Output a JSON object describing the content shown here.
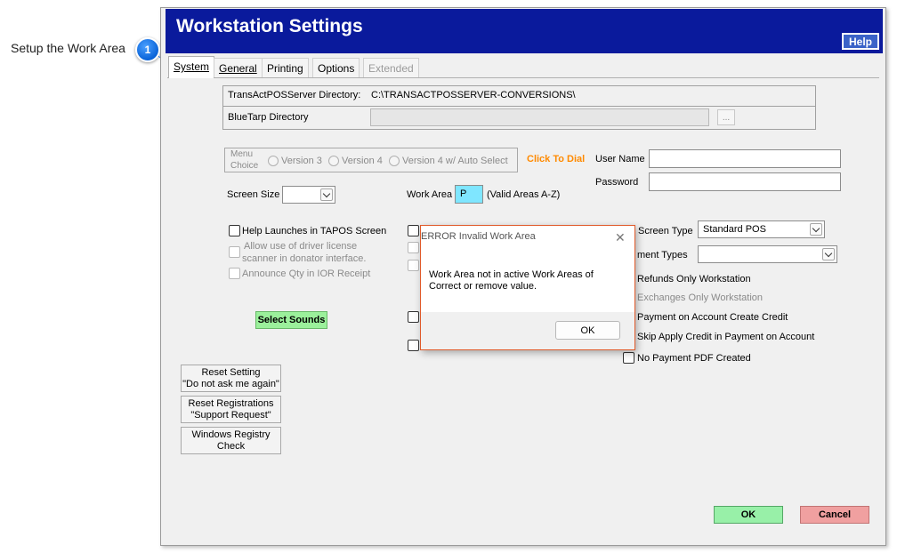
{
  "callout": {
    "label": "Setup the Work Area",
    "number": "1"
  },
  "window": {
    "title": "Workstation Settings",
    "help_label": "Help"
  },
  "tabs": [
    {
      "label": "System"
    },
    {
      "label": "General"
    },
    {
      "label": "Printing"
    },
    {
      "label": "Options"
    },
    {
      "label": "Extended"
    }
  ],
  "directories": {
    "server_label": "TransActPOSServer Directory:",
    "server_value": "C:\\TRANSACTPOSSERVER-CONVERSIONS\\",
    "bluetarp_label": "BlueTarp Directory",
    "browse_label": "..."
  },
  "menu_choice": {
    "label_line1": "Menu",
    "label_line2": "Choice",
    "options": [
      "Version 3",
      "Version 4",
      "Version 4 w/ Auto Select"
    ]
  },
  "click_to_dial": "Click To Dial",
  "login": {
    "username_label": "User Name",
    "password_label": "Password"
  },
  "screen_size_label": "Screen Size",
  "work_area": {
    "label": "Work Area",
    "value": "P",
    "hint": "(Valid Areas A-Z)"
  },
  "left_checks": {
    "help_launches": "Help Launches in TAPOS Screen",
    "driver_license_line1": "Allow use of driver license",
    "driver_license_line2": "scanner in donator interface.",
    "announce_qty": "Announce Qty in IOR Receipt"
  },
  "select_sounds": "Select Sounds",
  "right_panel": {
    "screen_type_label": "Screen Type",
    "screen_type_value": "Standard POS",
    "payment_types_label": "ment Types",
    "refunds_only": "Refunds Only Workstation",
    "exchanges_only": "Exchanges Only Workstation",
    "payment_on_account": "Payment on Account Create Credit",
    "skip_apply_credit": "Skip Apply Credit in Payment on Account",
    "no_payment_pdf": "No Payment PDF Created"
  },
  "reset_buttons": {
    "reset_setting_line1": "Reset Setting",
    "reset_setting_line2": "\"Do not ask me  again\"",
    "reset_registrations_line1": "Reset Registrations",
    "reset_registrations_line2": "\"Support Request\"",
    "registry_line1": "Windows Registry",
    "registry_line2": "Check"
  },
  "footer": {
    "ok_label": "OK",
    "cancel_label": "Cancel"
  },
  "dialog": {
    "title": "ERROR Invalid Work Area",
    "close_glyph": "✕",
    "message_line1": "Work Area not in active Work Areas of",
    "message_line2": "Correct or remove value.",
    "ok_label": "OK"
  },
  "colors": {
    "titlebar": "#0a1a9c",
    "work_area_field": "#7fe6ff",
    "select_sounds": "#9bf09b",
    "ok": "#98f0a8",
    "cancel": "#f0a0a0",
    "click_to_dial": "#ff8a00",
    "dialog_border": "#e05a2a"
  }
}
